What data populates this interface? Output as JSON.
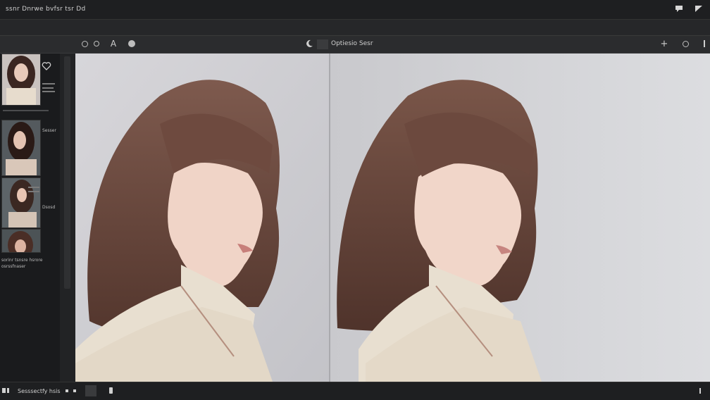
{
  "window": {
    "title": "ssnr Dnrwe bvfsr tsr Dd"
  },
  "toolbar": {
    "tool_icons": [
      "view-circle-icon",
      "view-dot-icon",
      "text-tool-icon",
      "info-circle-icon"
    ],
    "mode_icon": "crescent-icon",
    "mode_label": "Optiesio Sesr",
    "right_icons": [
      "add-icon",
      "settings-circle-icon",
      "more-vertical-icon"
    ]
  },
  "sidebar": {
    "captions": [
      "Sesser",
      "Dsosd"
    ],
    "info_text": "sorinr tsnsre hsrore\nosrssfnaser"
  },
  "status": {
    "label": "Sesssectfy hsis"
  },
  "colors": {
    "chrome": "#1e1f21",
    "toolbar": "#2b2c2e",
    "canvas": "#cfcfd3",
    "hair": "#6a4438",
    "sweater": "#e6dccb"
  }
}
